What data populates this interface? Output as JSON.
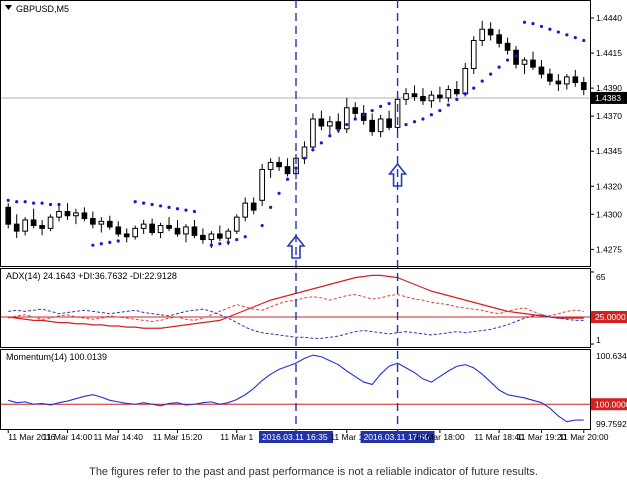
{
  "symbol_label": "GBPUSD,M5",
  "disclaimer": "The figures refer to the past and past performance is not a reliable indicator of future results.",
  "colors": {
    "candle": "#000000",
    "sar": "#1a1acc",
    "adx": "#d42020",
    "plus_di": "#e04040",
    "minus_di": "#2a3ab0",
    "momentum": "#2233cc",
    "level_line": "#d42020",
    "vline": "#2233aa",
    "arrow": "#2a3ab0",
    "highlight_bg": "#2233aa"
  },
  "chart_data": [
    {
      "type": "candlestick",
      "title": "GBPUSD,M5",
      "y_ticks": [
        "1.4440",
        "1.4415",
        "1.4390",
        "1.4370",
        "1.4345",
        "1.4320",
        "1.4300",
        "1.4275"
      ],
      "ylim": [
        1.4266,
        1.445
      ],
      "current_price": "1.4383",
      "current_value": 1.4383,
      "candles": [
        [
          1.4305,
          1.4308,
          1.429,
          1.4293
        ],
        [
          1.4293,
          1.43,
          1.4283,
          1.4288
        ],
        [
          1.4288,
          1.4298,
          1.4285,
          1.4296
        ],
        [
          1.4296,
          1.4304,
          1.429,
          1.4292
        ],
        [
          1.4292,
          1.4296,
          1.4285,
          1.429
        ],
        [
          1.429,
          1.43,
          1.4288,
          1.4298
        ],
        [
          1.4298,
          1.4306,
          1.4295,
          1.4302
        ],
        [
          1.4302,
          1.4308,
          1.4296,
          1.4299
        ],
        [
          1.4299,
          1.4304,
          1.4293,
          1.4301
        ],
        [
          1.4301,
          1.4305,
          1.4295,
          1.4297
        ],
        [
          1.4297,
          1.4302,
          1.429,
          1.4293
        ],
        [
          1.4293,
          1.4298,
          1.4287,
          1.4295
        ],
        [
          1.4295,
          1.4299,
          1.4289,
          1.4291
        ],
        [
          1.4291,
          1.4295,
          1.4284,
          1.4286
        ],
        [
          1.4286,
          1.429,
          1.428,
          1.4284
        ],
        [
          1.4284,
          1.4292,
          1.4282,
          1.429
        ],
        [
          1.429,
          1.4296,
          1.4286,
          1.4293
        ],
        [
          1.4293,
          1.4297,
          1.4285,
          1.4287
        ],
        [
          1.4287,
          1.4294,
          1.4283,
          1.4292
        ],
        [
          1.4292,
          1.4298,
          1.4288,
          1.429
        ],
        [
          1.429,
          1.4296,
          1.4284,
          1.4286
        ],
        [
          1.4286,
          1.4293,
          1.428,
          1.4291
        ],
        [
          1.4291,
          1.4296,
          1.4283,
          1.4285
        ],
        [
          1.4285,
          1.429,
          1.4279,
          1.4282
        ],
        [
          1.4282,
          1.4288,
          1.4276,
          1.4286
        ],
        [
          1.4286,
          1.4292,
          1.4281,
          1.4283
        ],
        [
          1.4283,
          1.429,
          1.4278,
          1.4288
        ],
        [
          1.4288,
          1.43,
          1.4286,
          1.4298
        ],
        [
          1.4298,
          1.4312,
          1.4295,
          1.4308
        ],
        [
          1.4308,
          1.4312,
          1.43,
          1.4303
        ],
        [
          1.431,
          1.4336,
          1.4306,
          1.4332
        ],
        [
          1.4332,
          1.434,
          1.4326,
          1.4337
        ],
        [
          1.4337,
          1.4341,
          1.4331,
          1.4334
        ],
        [
          1.4334,
          1.434,
          1.4327,
          1.4329
        ],
        [
          1.4329,
          1.4343,
          1.4325,
          1.434
        ],
        [
          1.434,
          1.4352,
          1.4336,
          1.4348
        ],
        [
          1.4348,
          1.4372,
          1.4345,
          1.4368
        ],
        [
          1.4368,
          1.4374,
          1.436,
          1.4363
        ],
        [
          1.4363,
          1.437,
          1.4356,
          1.4366
        ],
        [
          1.4366,
          1.4372,
          1.4358,
          1.4361
        ],
        [
          1.4361,
          1.4383,
          1.4358,
          1.4376
        ],
        [
          1.4376,
          1.438,
          1.4369,
          1.4372
        ],
        [
          1.4372,
          1.4378,
          1.4364,
          1.4367
        ],
        [
          1.4367,
          1.4372,
          1.4356,
          1.4359
        ],
        [
          1.4359,
          1.4371,
          1.4355,
          1.4368
        ],
        [
          1.4368,
          1.4374,
          1.436,
          1.4362
        ],
        [
          1.4362,
          1.4385,
          1.436,
          1.4382
        ],
        [
          1.4382,
          1.439,
          1.4378,
          1.4386
        ],
        [
          1.4386,
          1.4392,
          1.4381,
          1.4384
        ],
        [
          1.4384,
          1.439,
          1.4378,
          1.4381
        ],
        [
          1.4381,
          1.4388,
          1.4376,
          1.4385
        ],
        [
          1.4385,
          1.4391,
          1.438,
          1.4383
        ],
        [
          1.4383,
          1.4392,
          1.438,
          1.4389
        ],
        [
          1.4389,
          1.4395,
          1.4384,
          1.4386
        ],
        [
          1.4386,
          1.4408,
          1.4384,
          1.4404
        ],
        [
          1.4404,
          1.4427,
          1.44,
          1.4424
        ],
        [
          1.4424,
          1.4438,
          1.442,
          1.4432
        ],
        [
          1.4432,
          1.4437,
          1.4424,
          1.4428
        ],
        [
          1.4428,
          1.4432,
          1.4419,
          1.4422
        ],
        [
          1.4422,
          1.4426,
          1.4414,
          1.4417
        ],
        [
          1.4417,
          1.442,
          1.4404,
          1.4407
        ],
        [
          1.4407,
          1.4412,
          1.44,
          1.441
        ],
        [
          1.441,
          1.4416,
          1.4403,
          1.4405
        ],
        [
          1.4405,
          1.441,
          1.4397,
          1.44
        ],
        [
          1.44,
          1.4404,
          1.4392,
          1.4395
        ],
        [
          1.4395,
          1.44,
          1.4388,
          1.4393
        ],
        [
          1.4393,
          1.44,
          1.4389,
          1.4398
        ],
        [
          1.4398,
          1.4403,
          1.4391,
          1.4394
        ],
        [
          1.4394,
          1.4398,
          1.4385,
          1.4389
        ]
      ],
      "sar": [
        1.431,
        1.4309,
        1.4309,
        1.4308,
        1.4308,
        1.4307,
        1.4307,
        null,
        null,
        null,
        1.4278,
        1.4279,
        1.428,
        1.4281,
        null,
        1.4309,
        1.4308,
        1.4307,
        1.4306,
        1.4305,
        1.4304,
        1.4303,
        1.4302,
        null,
        1.4278,
        1.4279,
        1.428,
        1.4282,
        1.4284,
        null,
        1.4292,
        1.4305,
        1.4315,
        1.4325,
        1.4333,
        1.434,
        1.4346,
        1.4351,
        1.4356,
        1.436,
        1.4364,
        1.4368,
        1.4371,
        1.4374,
        1.4377,
        1.4379,
        null,
        1.4364,
        1.4366,
        1.4368,
        1.4371,
        1.4374,
        1.4378,
        1.4382,
        1.4386,
        1.439,
        1.4395,
        1.44,
        1.4405,
        1.441,
        1.4413,
        1.4437,
        1.4436,
        1.4434,
        1.4432,
        1.443,
        1.4428,
        1.4426,
        1.4424
      ],
      "vertical_markers": [
        {
          "index": 34,
          "label": "2016.03.11 16:35"
        },
        {
          "index": 46,
          "label": "2016.03.11 17:50"
        }
      ],
      "x_tick_labels": [
        "11 Mar 2016",
        "11 Mar 14:00",
        "11 Mar 14:40",
        "11 Mar 15:20",
        "11 Mar 1",
        "2016.03.11 16:35",
        "11 Mar 1",
        "2016.03.11 17:50",
        "11 Mar 18:00",
        "11 Mar 18:40",
        "11 Mar 19:20",
        "11 Mar 20:00"
      ],
      "x_tick_index": [
        0,
        7,
        13,
        20,
        27,
        34,
        40,
        46,
        51,
        58,
        63,
        68
      ]
    },
    {
      "type": "line",
      "title": "ADX(14) 24.1643 +DI:36.7632 -DI:22.9128",
      "y_ticks": [
        "65",
        "25.0000",
        "1"
      ],
      "ylim": [
        1,
        65
      ],
      "level": 25,
      "series": [
        {
          "name": "ADX",
          "values": [
            25,
            24,
            23,
            22,
            22,
            21,
            20,
            20,
            19,
            19,
            18,
            18,
            17,
            17,
            16,
            16,
            15,
            15,
            15,
            16,
            17,
            18,
            19,
            20,
            21,
            22,
            25,
            28,
            31,
            34,
            37,
            40,
            42,
            44,
            46,
            48,
            50,
            52,
            54,
            56,
            58,
            60,
            61,
            62,
            62,
            61,
            60,
            57,
            54,
            51,
            48,
            46,
            44,
            42,
            40,
            38,
            36,
            34,
            32,
            30,
            29,
            28,
            27,
            26,
            25,
            24,
            24,
            24,
            24
          ]
        },
        {
          "name": "+DI",
          "values": [
            24,
            26,
            27,
            25,
            23,
            24,
            26,
            27,
            25,
            24,
            23,
            24,
            26,
            25,
            24,
            23,
            22,
            21,
            22,
            24,
            25,
            23,
            22,
            24,
            27,
            30,
            33,
            36,
            34,
            32,
            31,
            34,
            37,
            39,
            40,
            42,
            43,
            42,
            40,
            42,
            44,
            45,
            43,
            41,
            42,
            44,
            45,
            43,
            41,
            40,
            38,
            37,
            36,
            34,
            33,
            32,
            31,
            29,
            28,
            30,
            32,
            33,
            30,
            27,
            26,
            28,
            30,
            31,
            30
          ]
        },
        {
          "name": "-DI",
          "values": [
            30,
            31,
            30,
            31,
            32,
            30,
            28,
            29,
            30,
            31,
            30,
            29,
            28,
            29,
            30,
            31,
            29,
            28,
            27,
            26,
            28,
            30,
            31,
            32,
            30,
            27,
            24,
            20,
            16,
            13,
            11,
            10,
            9,
            8,
            7,
            7,
            6,
            6,
            7,
            8,
            10,
            12,
            13,
            12,
            11,
            10,
            11,
            12,
            11,
            10,
            9,
            10,
            11,
            12,
            11,
            12,
            13,
            14,
            16,
            18,
            21,
            24,
            26,
            27,
            25,
            24,
            23,
            22,
            22
          ]
        }
      ]
    },
    {
      "type": "line",
      "title": "Momentum(14) 100.0139",
      "y_ticks": [
        "100.6348",
        "100.0000",
        "99.7592"
      ],
      "ylim": [
        99.7,
        100.66
      ],
      "level": 100.0,
      "series": [
        {
          "name": "Momentum",
          "values": [
            100.05,
            100.02,
            100.03,
            100.0,
            100.01,
            99.99,
            100.02,
            100.04,
            100.07,
            100.1,
            100.12,
            100.09,
            100.05,
            100.03,
            100.01,
            100.0,
            100.02,
            100.0,
            99.98,
            100.01,
            100.02,
            99.99,
            100.0,
            100.02,
            100.03,
            100.0,
            100.02,
            100.06,
            100.12,
            100.2,
            100.3,
            100.38,
            100.44,
            100.48,
            100.52,
            100.58,
            100.62,
            100.6,
            100.55,
            100.5,
            100.42,
            100.35,
            100.28,
            100.25,
            100.38,
            100.48,
            100.52,
            100.46,
            100.4,
            100.32,
            100.28,
            100.35,
            100.42,
            100.48,
            100.5,
            100.46,
            100.38,
            100.28,
            100.18,
            100.12,
            100.1,
            100.08,
            100.05,
            100.02,
            99.95,
            99.85,
            99.78,
            99.8,
            99.8
          ]
        }
      ]
    }
  ]
}
